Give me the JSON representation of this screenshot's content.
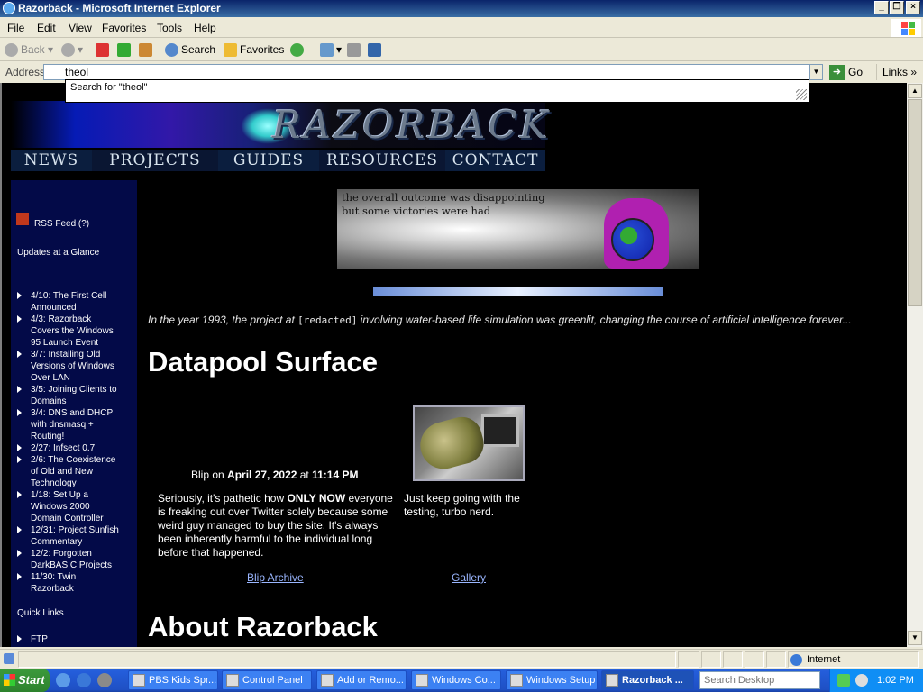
{
  "window": {
    "title": "Razorback - Microsoft Internet Explorer"
  },
  "menubar": {
    "items": [
      "File",
      "Edit",
      "View",
      "Favorites",
      "Tools",
      "Help"
    ]
  },
  "toolbar": {
    "back": "Back",
    "search": "Search",
    "favorites": "Favorites"
  },
  "address": {
    "label": "Address",
    "value": "theol",
    "go": "Go",
    "links": "Links",
    "suggestion": "Search for \"theol\""
  },
  "page": {
    "logo_text": "RAZORBACK",
    "nav": [
      "NEWS",
      "PROJECTS",
      "GUIDES",
      "RESOURCES",
      "CONTACT"
    ],
    "sidebar": {
      "rss": "RSS Feed (?)",
      "updates_heading": "Updates at a Glance",
      "updates": [
        "4/10: The First Cell Announced",
        "4/3: Razorback Covers the Windows 95 Launch Event",
        "3/7: Installing Old Versions of Windows Over LAN",
        "3/5: Joining Clients to Domains",
        "3/4: DNS and DHCP with dnsmasq + Routing!",
        "2/27: Infsect 0.7",
        "2/6: The Coexistence of Old and New Technology",
        "1/18: Set Up a Windows 2000 Domain Controller",
        "12/31: Project Sunfish Commentary",
        "12/2: Forgotten DarkBASIC Projects",
        "11/30: Twin Razorback"
      ],
      "quick_links_heading": "Quick Links",
      "quick_links": [
        "FTP"
      ]
    },
    "hero_caption_1": "the overall outcome was disappointing",
    "hero_caption_2": "but some victories were had",
    "intro_pre": "In the year 1993, the project at ",
    "intro_code": "[redacted]",
    "intro_post": " involving water-based life simulation was greenlit, changing the course of artificial intelligence forever...",
    "heading_datapool": "Datapool Surface",
    "blip_prefix": "Blip on ",
    "blip_date": "April 27, 2022",
    "blip_at": " at ",
    "blip_time": "11:14 PM",
    "blip_text_1": "Seriously, it's pathetic how ",
    "blip_text_bold": "ONLY NOW",
    "blip_text_2": " everyone is freaking out over Twitter solely because some weird guy managed to buy the site. It's always been inherently harmful to the individual long before that happened.",
    "gallery_text": "Just keep going with the testing, turbo nerd.",
    "blip_archive": "Blip Archive",
    "gallery": "Gallery",
    "heading_about": "About Razorback"
  },
  "statusbar": {
    "zone": "Internet"
  },
  "taskbar": {
    "start": "Start",
    "buttons": [
      "PBS Kids Spr...",
      "Control Panel",
      "Add or Remo...",
      "Windows Co...",
      "Windows Setup",
      "Razorback ..."
    ],
    "search_placeholder": "Search Desktop",
    "clock": "1:02 PM"
  }
}
